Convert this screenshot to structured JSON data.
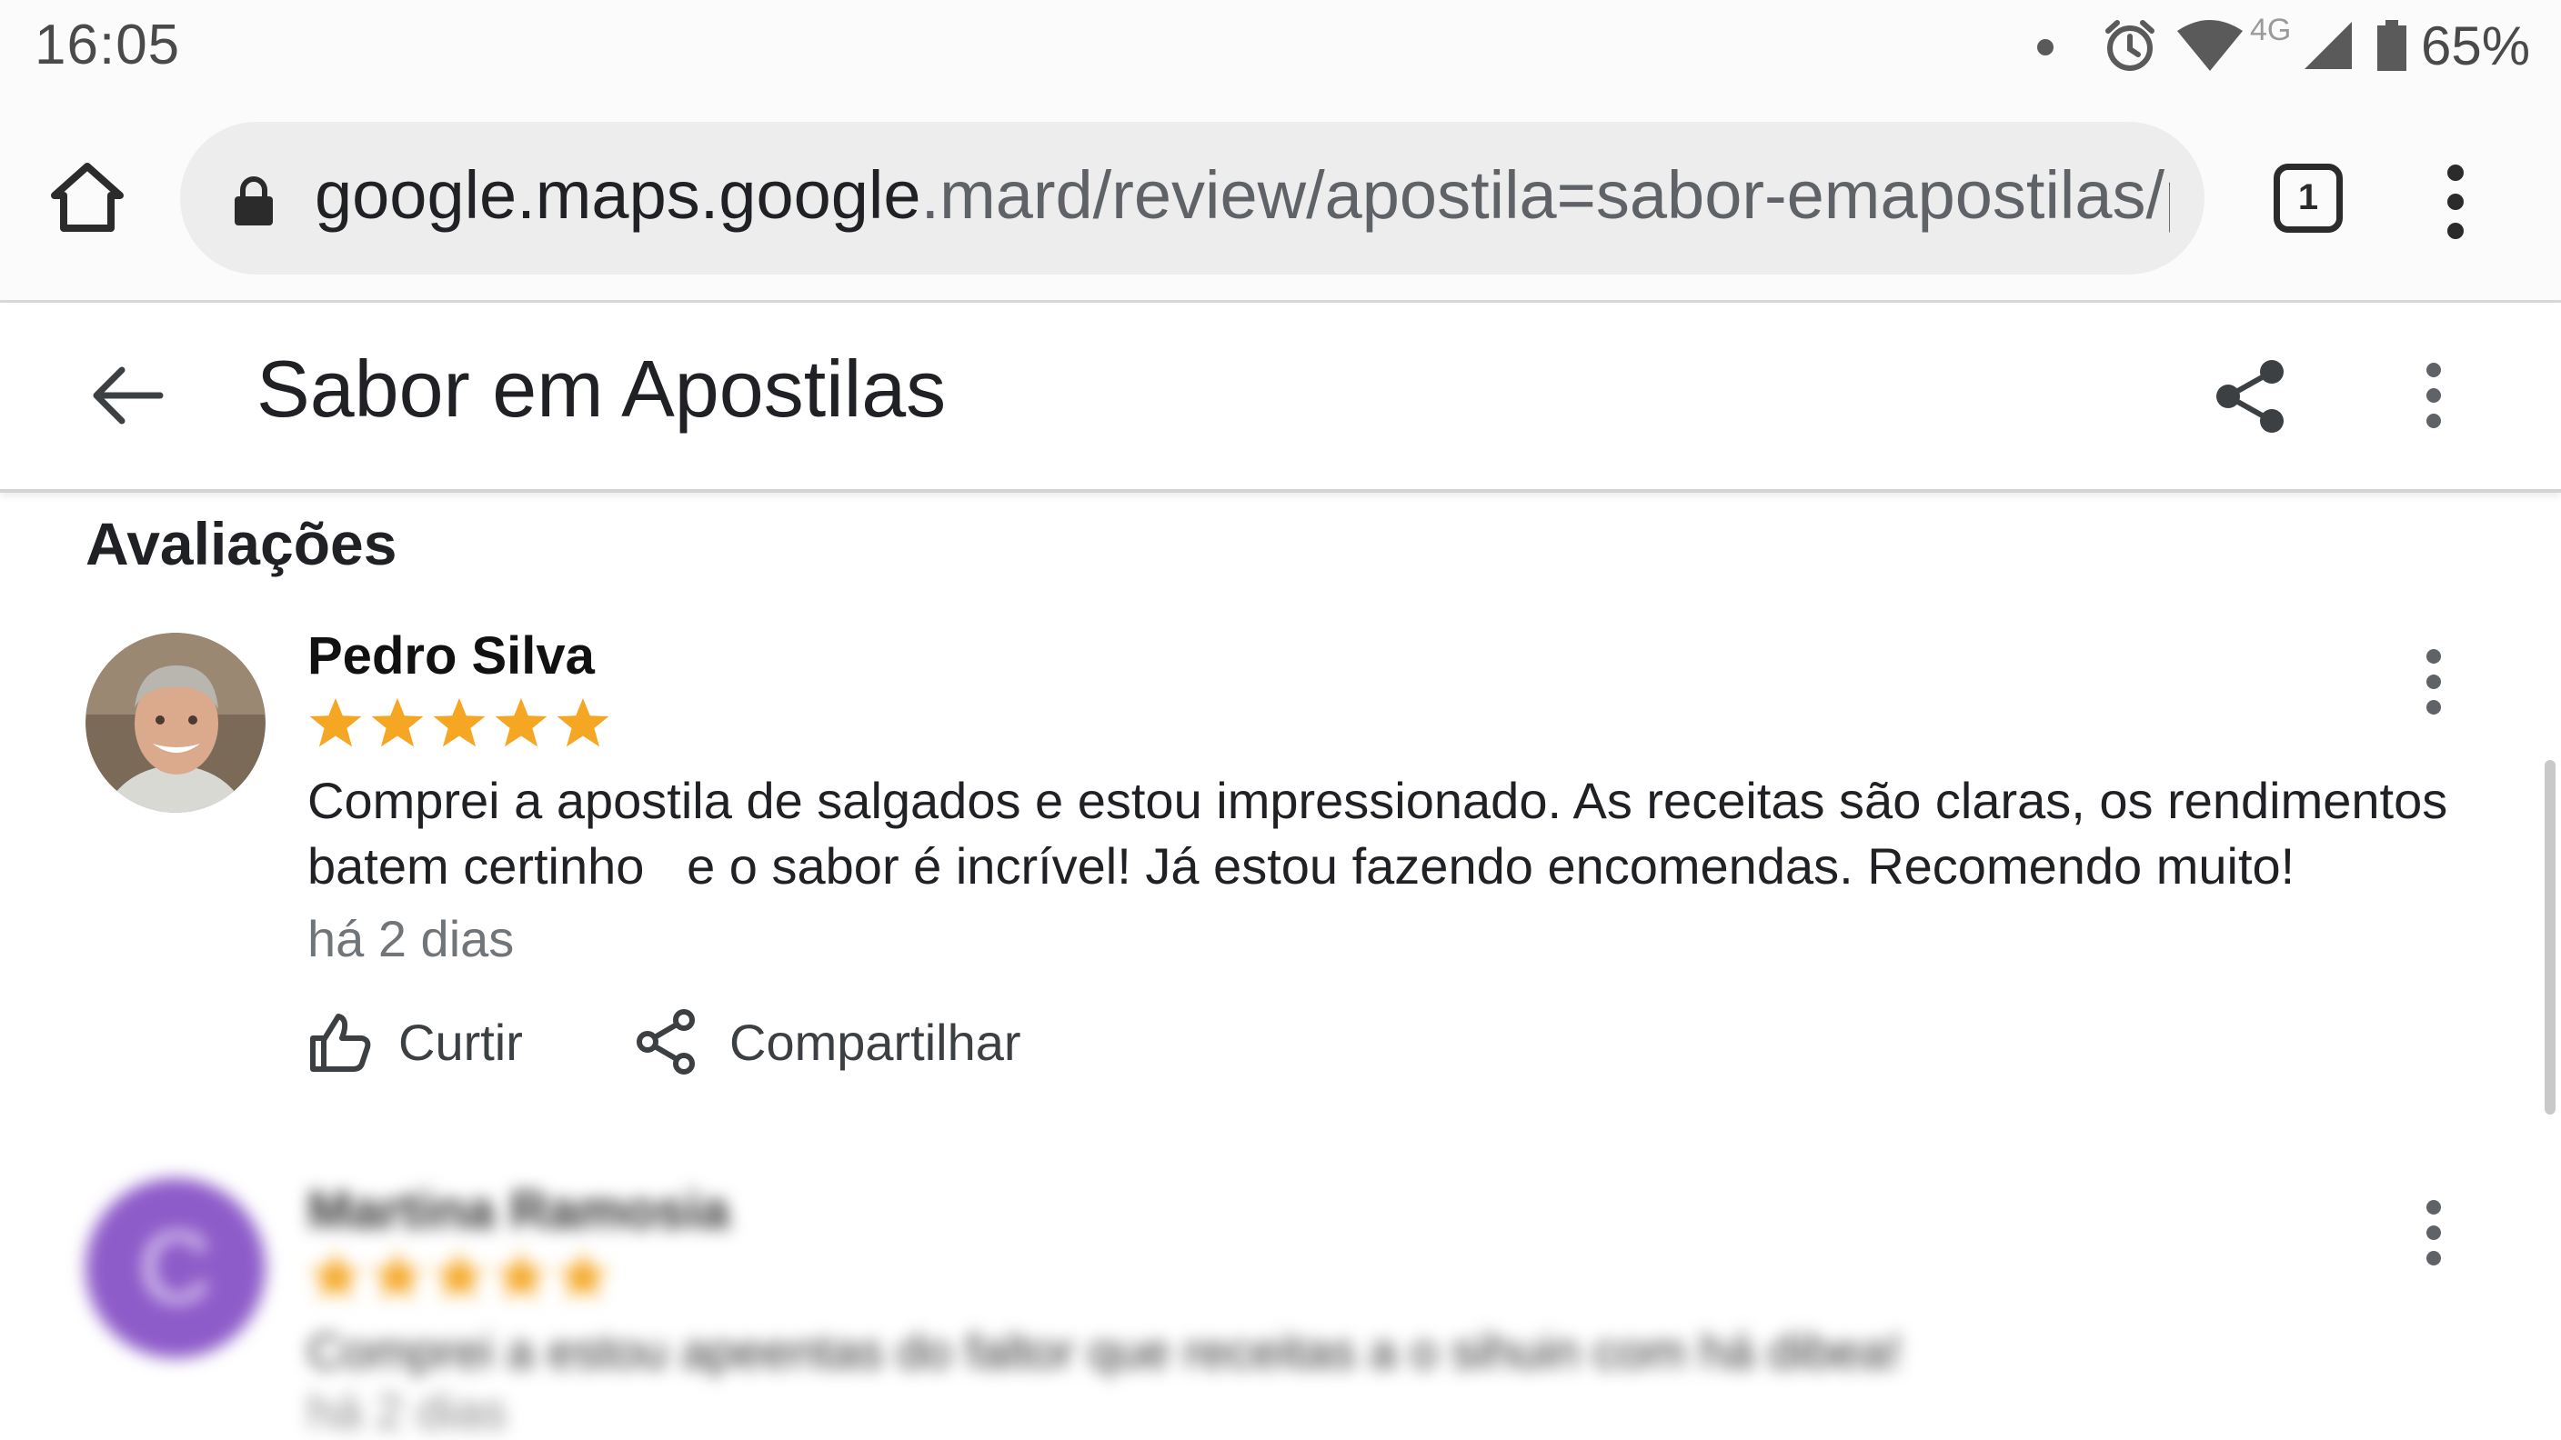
{
  "status_bar": {
    "time": "16:05",
    "network": "4G",
    "battery": "65%",
    "icons": [
      "notification-dot-icon",
      "alarm-icon",
      "wifi-icon",
      "signal-icon",
      "battery-icon"
    ]
  },
  "browser": {
    "url_host": "google.maps.google",
    "url_path": ".mard/review/apostila=sabor-emapostilas/pr",
    "tab_count": "1",
    "icons": [
      "home-icon",
      "lock-icon",
      "tabs-icon",
      "more-vert-icon"
    ]
  },
  "app_header": {
    "title": "Sabor em Apostilas",
    "icons": [
      "back-arrow-icon",
      "share-icon",
      "more-vert-icon"
    ]
  },
  "reviews_section": {
    "title": "Avaliações",
    "reviews": [
      {
        "name": "Pedro Silva",
        "rating": 5,
        "text": "Comprei a apostila de salgados e estou impressionado. As receitas são claras, os rendimentos batem certinho   e o sabor é incrível! Já estou fazendo encomendas. Recomendo muito!",
        "time": "há 2 dias",
        "like_label": "Curtir",
        "share_label": "Compartilhar"
      },
      {
        "name": "Martina Ramosia",
        "avatar_letter": "C",
        "rating": 5,
        "text": "Comprei a estou apeentas do faltor que receitas a o sihuin com há dibea!",
        "time": "há 2 dias",
        "blurred": true
      }
    ]
  },
  "colors": {
    "star": "#f5a623",
    "avatar2_bg": "#8e5cc9",
    "text_primary": "#202124",
    "text_secondary": "#70757a",
    "url_bar_bg": "#ededed"
  }
}
